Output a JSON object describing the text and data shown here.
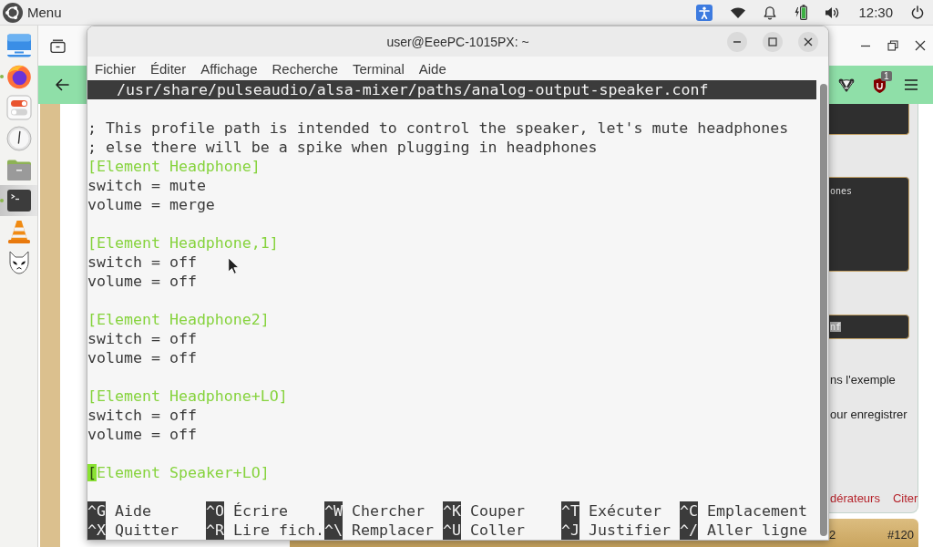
{
  "top_bar": {
    "menu_label": "Menu",
    "clock": "12:30"
  },
  "dock": [
    {
      "selected": false,
      "running": false
    },
    {
      "selected": false,
      "running": true
    },
    {
      "selected": false,
      "running": false
    },
    {
      "selected": false,
      "running": false
    },
    {
      "selected": false,
      "running": false
    },
    {
      "selected": true,
      "running": true
    },
    {
      "selected": false,
      "running": false
    },
    {
      "selected": false,
      "running": false
    }
  ],
  "browser": {
    "toolbar": {
      "extension_badge": "1"
    },
    "post": {
      "blocks": [
        {
          "kind": "code"
        },
        {
          "kind": "code",
          "text": "ones",
          "highlighted": false
        },
        {
          "kind": "code",
          "text": "nf",
          "highlighted": true
        },
        {
          "kind": "text",
          "text": "ns l'exemple",
          "highlighted": false
        },
        {
          "kind": "text",
          "text": "our enregistrer",
          "highlighted": false
        }
      ],
      "links": [
        "dérateurs",
        "Citer"
      ]
    },
    "next_post": {
      "text_fragment": "2",
      "number": "#120"
    }
  },
  "terminal": {
    "title": "user@EeePC-1015PX: ~",
    "menu": [
      "Fichier",
      "Éditer",
      "Affichage",
      "Recherche",
      "Terminal",
      "Aide"
    ],
    "editor": {
      "file_path": "/usr/share/pulseaudio/alsa-mixer/paths/analog-output-speaker.conf",
      "lines": [
        {
          "kind": "blank",
          "cursor": false
        },
        {
          "kind": "comment",
          "text": "; This profile path is intended to control the speaker, let's mute headphones",
          "cursor": false
        },
        {
          "kind": "comment",
          "text": "; else there will be a spike when plugging in headphones",
          "cursor": false
        },
        {
          "kind": "section",
          "text": "[Element Headphone]",
          "cursor": false
        },
        {
          "kind": "setting",
          "text": "switch = mute",
          "cursor": false
        },
        {
          "kind": "setting",
          "text": "volume = merge",
          "cursor": false
        },
        {
          "kind": "blank",
          "cursor": false
        },
        {
          "kind": "section",
          "text": "[Element Headphone,1]",
          "cursor": false
        },
        {
          "kind": "setting",
          "text": "switch = off",
          "cursor": false
        },
        {
          "kind": "setting",
          "text": "volume = off",
          "cursor": false
        },
        {
          "kind": "blank",
          "cursor": false
        },
        {
          "kind": "section",
          "text": "[Element Headphone2]",
          "cursor": false
        },
        {
          "kind": "setting",
          "text": "switch = off",
          "cursor": false
        },
        {
          "kind": "setting",
          "text": "volume = off",
          "cursor": false
        },
        {
          "kind": "blank",
          "cursor": false
        },
        {
          "kind": "section",
          "text": "[Element Headphone+LO]",
          "cursor": false
        },
        {
          "kind": "setting",
          "text": "switch = off",
          "cursor": false
        },
        {
          "kind": "setting",
          "text": "volume = off",
          "cursor": false
        },
        {
          "kind": "blank",
          "cursor": false
        },
        {
          "kind": "section",
          "text": "[Element Speaker+LO]",
          "cursor": true
        }
      ],
      "shortcuts": [
        [
          {
            "key": "^G",
            "label": "Aide"
          },
          {
            "key": "^O",
            "label": "Écrire"
          },
          {
            "key": "^W",
            "label": "Chercher"
          },
          {
            "key": "^K",
            "label": "Couper"
          },
          {
            "key": "^T",
            "label": "Exécuter"
          },
          {
            "key": "^C",
            "label": "Emplacement"
          }
        ],
        [
          {
            "key": "^X",
            "label": "Quitter"
          },
          {
            "key": "^R",
            "label": "Lire fich."
          },
          {
            "key": "^\\",
            "label": "Remplacer"
          },
          {
            "key": "^U",
            "label": "Coller"
          },
          {
            "key": "^J",
            "label": "Justifier"
          },
          {
            "key": "^/",
            "label": "Aller ligne"
          }
        ]
      ]
    }
  }
}
